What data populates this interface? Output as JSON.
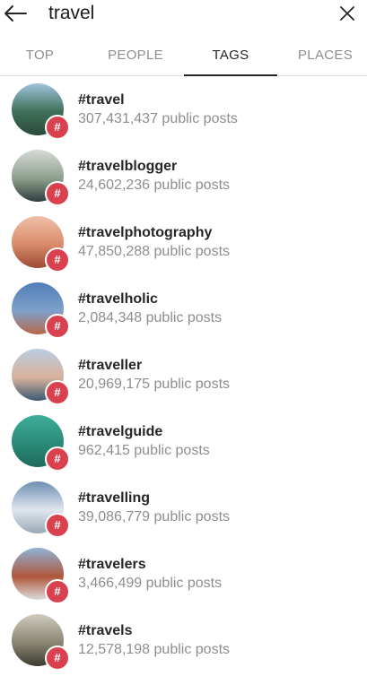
{
  "search": {
    "query": "travel",
    "back_icon": "back-arrow-icon",
    "clear_icon": "close-icon"
  },
  "tabs": [
    {
      "label": "TOP",
      "active": false
    },
    {
      "label": "PEOPLE",
      "active": false
    },
    {
      "label": "TAGS",
      "active": true
    },
    {
      "label": "PLACES",
      "active": false
    }
  ],
  "badge_glyph": "#",
  "results": [
    {
      "tag": "#travel",
      "posts": "307,431,437 public posts",
      "thumb": [
        "#9fc3dc",
        "#3f6f58",
        "#2a4a3a"
      ]
    },
    {
      "tag": "#travelblogger",
      "posts": "24,602,236 public posts",
      "thumb": [
        "#d5dad6",
        "#8fa08d",
        "#2f3d3f"
      ]
    },
    {
      "tag": "#travelphotography",
      "posts": "47,850,288 public posts",
      "thumb": [
        "#f0c1a8",
        "#d98a6a",
        "#9c4b34"
      ]
    },
    {
      "tag": "#travelholic",
      "posts": "2,084,348 public posts",
      "thumb": [
        "#4f7fb8",
        "#7fa0c9",
        "#b5674a"
      ]
    },
    {
      "tag": "#traveller",
      "posts": "20,969,175 public posts",
      "thumb": [
        "#b9cde2",
        "#d9b29c",
        "#3b5a73"
      ]
    },
    {
      "tag": "#travelguide",
      "posts": "962,415 public posts",
      "thumb": [
        "#3fae9a",
        "#2a8a77",
        "#1f6a5c"
      ]
    },
    {
      "tag": "#travelling",
      "posts": "39,086,779 public posts",
      "thumb": [
        "#6e8fb3",
        "#dfe6ee",
        "#9aa9b5"
      ]
    },
    {
      "tag": "#travelers",
      "posts": "3,466,499 public posts",
      "thumb": [
        "#8fb3d6",
        "#b0573b",
        "#dcdcdc"
      ]
    },
    {
      "tag": "#travels",
      "posts": "12,578,198 public posts",
      "thumb": [
        "#cfcbbd",
        "#8a8672",
        "#3d3b31"
      ]
    }
  ]
}
